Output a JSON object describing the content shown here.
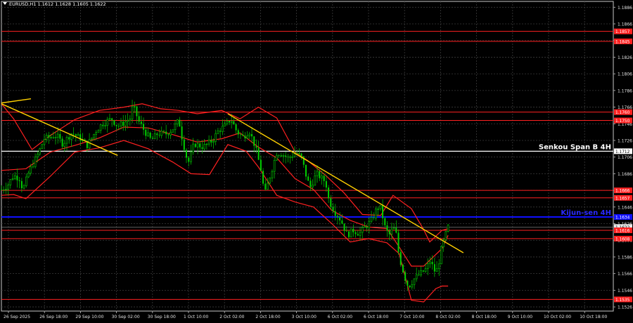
{
  "header": {
    "symbol": "EURUSD,H1",
    "open": "1.1612",
    "high": "1.1628",
    "low": "1.1605",
    "close": "1.1622"
  },
  "chart_data": {
    "type": "candlestick",
    "ylim": [
      1.1521,
      1.1893
    ],
    "y_ticks": [
      "1.1886",
      "1.1866",
      "1.1846",
      "1.1826",
      "1.1806",
      "1.1786",
      "1.1766",
      "1.1746",
      "1.1726",
      "1.1706",
      "1.1686",
      "1.1666",
      "1.1646",
      "1.1626",
      "1.1606",
      "1.1586",
      "1.1566",
      "1.1546",
      "1.1526"
    ],
    "x_ticks": [
      "26 Sep 2025",
      "26 Sep 18:00",
      "29 Sep 10:00",
      "30 Sep 02:00",
      "30 Sep 18:00",
      "1 Oct 10:00",
      "2 Oct 02:00",
      "2 Oct 18:00",
      "3 Oct 10:00",
      "6 Oct 02:00",
      "6 Oct 18:00",
      "7 Oct 10:00",
      "8 Oct 02:00",
      "8 Oct 18:00",
      "9 Oct 10:00",
      "10 Oct 02:00",
      "10 Oct 18:00"
    ],
    "levels": [
      {
        "price": 1.1857,
        "label": "1.1857",
        "color": "#ff2020"
      },
      {
        "price": 1.1845,
        "label": "1.1845",
        "color": "#ff2020"
      },
      {
        "price": 1.176,
        "label": "1.1760",
        "color": "#ff2020"
      },
      {
        "price": 1.175,
        "label": "1.1750",
        "color": "#ff2020"
      },
      {
        "price": 1.1713,
        "label": "1.1712",
        "color": "#ffffff",
        "name": "Senkou Span B 4H"
      },
      {
        "price": 1.1666,
        "label": "1.1666",
        "color": "#ff2020"
      },
      {
        "price": 1.1657,
        "label": "1.1657",
        "color": "#ff2020"
      },
      {
        "price": 1.1634,
        "label": "1.1634",
        "color": "#1010ff",
        "name": "Kijun-sen 4H"
      },
      {
        "price": 1.1622,
        "label": "1.1622",
        "color": "#c0c0c0",
        "current": true
      },
      {
        "price": 1.1618,
        "label": "1.1616",
        "color": "#ff2020"
      },
      {
        "price": 1.1608,
        "label": "1.1608",
        "color": "#ff2020"
      },
      {
        "price": 1.1535,
        "label": "1.1535",
        "color": "#ff2020"
      }
    ],
    "trend_lines": [
      {
        "from": [
          0,
          1.1771
        ],
        "to": [
          8,
          1.1776
        ],
        "color": "#ffd000"
      },
      {
        "from": [
          0,
          1.177
        ],
        "to": [
          0.19,
          1.1708
        ],
        "color": "#ffd000"
      },
      {
        "from": [
          0.37,
          1.1758
        ],
        "to": [
          0.755,
          1.1591
        ],
        "color": "#ffd000"
      }
    ],
    "bb_upper": [
      [
        0,
        1.177
      ],
      [
        0.02,
        1.1752
      ],
      [
        0.05,
        1.1715
      ],
      [
        0.08,
        1.1732
      ],
      [
        0.12,
        1.1751
      ],
      [
        0.16,
        1.1762
      ],
      [
        0.2,
        1.1766
      ],
      [
        0.23,
        1.177
      ],
      [
        0.26,
        1.1764
      ],
      [
        0.29,
        1.1762
      ],
      [
        0.32,
        1.1758
      ],
      [
        0.36,
        1.1762
      ],
      [
        0.39,
        1.1752
      ],
      [
        0.42,
        1.1766
      ],
      [
        0.45,
        1.1753
      ],
      [
        0.48,
        1.1712
      ],
      [
        0.5,
        1.1702
      ],
      [
        0.53,
        1.1684
      ],
      [
        0.56,
        1.1663
      ],
      [
        0.59,
        1.1637
      ],
      [
        0.62,
        1.1636
      ],
      [
        0.64,
        1.166
      ],
      [
        0.67,
        1.1644
      ],
      [
        0.69,
        1.1619
      ],
      [
        0.7,
        1.1604
      ],
      [
        0.72,
        1.1618
      ],
      [
        0.73,
        1.162
      ]
    ],
    "bb_mid": [
      [
        0,
        1.169
      ],
      [
        0.04,
        1.1692
      ],
      [
        0.08,
        1.1712
      ],
      [
        0.12,
        1.172
      ],
      [
        0.16,
        1.1729
      ],
      [
        0.2,
        1.1742
      ],
      [
        0.24,
        1.1741
      ],
      [
        0.28,
        1.1733
      ],
      [
        0.32,
        1.1724
      ],
      [
        0.36,
        1.1728
      ],
      [
        0.39,
        1.1735
      ],
      [
        0.42,
        1.1718
      ],
      [
        0.45,
        1.1705
      ],
      [
        0.48,
        1.168
      ],
      [
        0.51,
        1.1667
      ],
      [
        0.54,
        1.1642
      ],
      [
        0.57,
        1.163
      ],
      [
        0.6,
        1.1622
      ],
      [
        0.63,
        1.162
      ],
      [
        0.65,
        1.1598
      ],
      [
        0.67,
        1.1575
      ],
      [
        0.69,
        1.1575
      ],
      [
        0.7,
        1.1582
      ],
      [
        0.72,
        1.1596
      ],
      [
        0.73,
        1.1612
      ]
    ],
    "bb_lower": [
      [
        0,
        1.166
      ],
      [
        0.02,
        1.1661
      ],
      [
        0.04,
        1.1656
      ],
      [
        0.08,
        1.1683
      ],
      [
        0.12,
        1.1712
      ],
      [
        0.16,
        1.1717
      ],
      [
        0.2,
        1.1726
      ],
      [
        0.24,
        1.1716
      ],
      [
        0.28,
        1.17
      ],
      [
        0.31,
        1.1686
      ],
      [
        0.34,
        1.1685
      ],
      [
        0.37,
        1.1721
      ],
      [
        0.4,
        1.1713
      ],
      [
        0.42,
        1.1694
      ],
      [
        0.45,
        1.166
      ],
      [
        0.48,
        1.1652
      ],
      [
        0.51,
        1.1646
      ],
      [
        0.54,
        1.1626
      ],
      [
        0.57,
        1.1604
      ],
      [
        0.6,
        1.1608
      ],
      [
        0.63,
        1.1603
      ],
      [
        0.65,
        1.159
      ],
      [
        0.67,
        1.1534
      ],
      [
        0.69,
        1.1532
      ],
      [
        0.71,
        1.1548
      ],
      [
        0.72,
        1.1551
      ],
      [
        0.73,
        1.1551
      ]
    ],
    "price_path": [
      [
        0,
        1.1667
      ],
      [
        0.01,
        1.1672
      ],
      [
        0.02,
        1.1684
      ],
      [
        0.03,
        1.168
      ],
      [
        0.035,
        1.1666
      ],
      [
        0.045,
        1.1688
      ],
      [
        0.06,
        1.171
      ],
      [
        0.07,
        1.1728
      ],
      [
        0.09,
        1.1732
      ],
      [
        0.1,
        1.1722
      ],
      [
        0.115,
        1.1735
      ],
      [
        0.13,
        1.1728
      ],
      [
        0.14,
        1.172
      ],
      [
        0.155,
        1.1738
      ],
      [
        0.165,
        1.1746
      ],
      [
        0.18,
        1.1752
      ],
      [
        0.19,
        1.1743
      ],
      [
        0.2,
        1.1747
      ],
      [
        0.21,
        1.1752
      ],
      [
        0.215,
        1.1768
      ],
      [
        0.225,
        1.1748
      ],
      [
        0.235,
        1.1736
      ],
      [
        0.245,
        1.1726
      ],
      [
        0.255,
        1.1734
      ],
      [
        0.27,
        1.1734
      ],
      [
        0.28,
        1.174
      ],
      [
        0.29,
        1.175
      ],
      [
        0.295,
        1.173
      ],
      [
        0.305,
        1.1698
      ],
      [
        0.315,
        1.1722
      ],
      [
        0.33,
        1.1718
      ],
      [
        0.345,
        1.1726
      ],
      [
        0.355,
        1.1738
      ],
      [
        0.365,
        1.1743
      ],
      [
        0.375,
        1.1752
      ],
      [
        0.385,
        1.1736
      ],
      [
        0.395,
        1.173
      ],
      [
        0.405,
        1.1738
      ],
      [
        0.415,
        1.1718
      ],
      [
        0.425,
        1.1688
      ],
      [
        0.43,
        1.166
      ],
      [
        0.44,
        1.1686
      ],
      [
        0.45,
        1.1712
      ],
      [
        0.46,
        1.1709
      ],
      [
        0.47,
        1.1704
      ],
      [
        0.48,
        1.1712
      ],
      [
        0.49,
        1.1706
      ],
      [
        0.5,
        1.1678
      ],
      [
        0.505,
        1.167
      ],
      [
        0.515,
        1.1686
      ],
      [
        0.53,
        1.1676
      ],
      [
        0.535,
        1.1654
      ],
      [
        0.545,
        1.164
      ],
      [
        0.555,
        1.163
      ],
      [
        0.565,
        1.1612
      ],
      [
        0.575,
        1.1618
      ],
      [
        0.585,
        1.1614
      ],
      [
        0.595,
        1.1622
      ],
      [
        0.605,
        1.163
      ],
      [
        0.615,
        1.1646
      ],
      [
        0.62,
        1.1644
      ],
      [
        0.628,
        1.1618
      ],
      [
        0.635,
        1.1612
      ],
      [
        0.64,
        1.1622
      ],
      [
        0.645,
        1.1614
      ],
      [
        0.65,
        1.1586
      ],
      [
        0.66,
        1.156
      ],
      [
        0.665,
        1.155
      ],
      [
        0.675,
        1.156
      ],
      [
        0.685,
        1.1566
      ],
      [
        0.695,
        1.1572
      ],
      [
        0.7,
        1.1582
      ],
      [
        0.71,
        1.1566
      ],
      [
        0.715,
        1.158
      ],
      [
        0.72,
        1.1598
      ],
      [
        0.73,
        1.1622
      ]
    ]
  },
  "labels": {
    "senkou": "Senkou Span B 4H",
    "kijun": "Kijun-sen 4H"
  }
}
